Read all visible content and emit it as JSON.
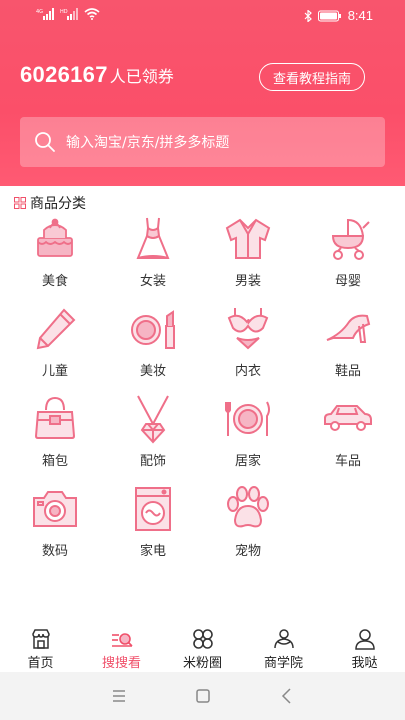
{
  "status": {
    "time": "8:41",
    "signal1": "4G",
    "signal2": "HD"
  },
  "header": {
    "count": "6026167",
    "count_suffix": "人已领券",
    "guide_button": "查看教程指南"
  },
  "search": {
    "placeholder": "输入淘宝/京东/拼多多标题"
  },
  "section": {
    "title": "商品分类"
  },
  "categories": [
    {
      "label": "美食",
      "icon": "cake-icon"
    },
    {
      "label": "女装",
      "icon": "dress-icon"
    },
    {
      "label": "男装",
      "icon": "shirt-icon"
    },
    {
      "label": "母婴",
      "icon": "stroller-icon"
    },
    {
      "label": "儿童",
      "icon": "pencil-icon"
    },
    {
      "label": "美妆",
      "icon": "makeup-icon"
    },
    {
      "label": "内衣",
      "icon": "bra-icon"
    },
    {
      "label": "鞋品",
      "icon": "high-heel-icon"
    },
    {
      "label": "箱包",
      "icon": "handbag-icon"
    },
    {
      "label": "配饰",
      "icon": "necklace-icon"
    },
    {
      "label": "居家",
      "icon": "dining-icon"
    },
    {
      "label": "车品",
      "icon": "car-icon"
    },
    {
      "label": "数码",
      "icon": "camera-icon"
    },
    {
      "label": "家电",
      "icon": "washing-machine-icon"
    },
    {
      "label": "宠物",
      "icon": "paw-icon"
    }
  ],
  "tabs": [
    {
      "label": "首页",
      "icon": "store-icon",
      "active": false
    },
    {
      "label": "搜搜看",
      "icon": "search-list-icon",
      "active": true
    },
    {
      "label": "米粉圈",
      "icon": "clover-icon",
      "active": false
    },
    {
      "label": "商学院",
      "icon": "school-icon",
      "active": false
    },
    {
      "label": "我哒",
      "icon": "user-icon",
      "active": false
    }
  ],
  "colors": {
    "accent": "#f0506a",
    "icon": "#ef6f89",
    "hero": "#fb4f69"
  }
}
